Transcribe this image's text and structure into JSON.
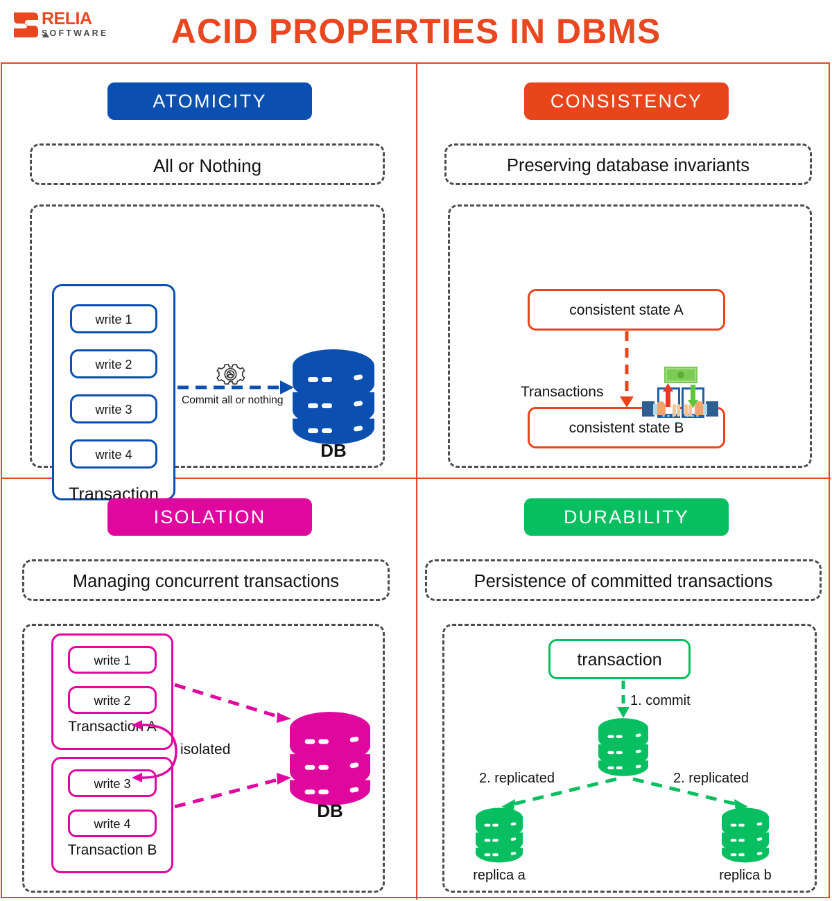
{
  "brand": {
    "name": "RELIA",
    "subname": "SOFTWARE",
    "color": "#E8471F"
  },
  "header": {
    "title": "ACID PROPERTIES IN DBMS",
    "title_color": "#E8471F"
  },
  "quadrants": {
    "atomicity": {
      "badge": "ATOMICITY",
      "badge_color": "#0B4FB0",
      "subtitle": "All or Nothing",
      "transaction_label": "Transaction",
      "writes": [
        "write 1",
        "write 2",
        "write 3",
        "write 4"
      ],
      "arrow_label": "Commit all or nothing",
      "db_label": "DB",
      "gear_icon": "gear-icon"
    },
    "consistency": {
      "badge": "CONSISTENCY",
      "badge_color": "#E8451C",
      "subtitle": "Preserving database invariants",
      "state_a": "consistent state A",
      "state_b": "consistent state B",
      "arrow_label": "Transactions",
      "money_icon": "money-transfer-icon"
    },
    "isolation": {
      "badge": "ISOLATION",
      "badge_color": "#E0079F",
      "subtitle": "Managing concurrent transactions",
      "transaction_a_label": "Transaction A",
      "transaction_b_label": "Transaction B",
      "writes_a": [
        "write 1",
        "write 2"
      ],
      "writes_b": [
        "write 3",
        "write 4"
      ],
      "isolated_label": "isolated",
      "db_label": "DB"
    },
    "durability": {
      "badge": "DURABILITY",
      "badge_color": "#07BF60",
      "subtitle": "Persistence of committed transactions",
      "transaction_label": "transaction",
      "commit_label": "1. commit",
      "replicated_left_label": "2. replicated",
      "replicated_right_label": "2. replicated",
      "replica_a_label": "replica a",
      "replica_b_label": "replica b"
    }
  }
}
